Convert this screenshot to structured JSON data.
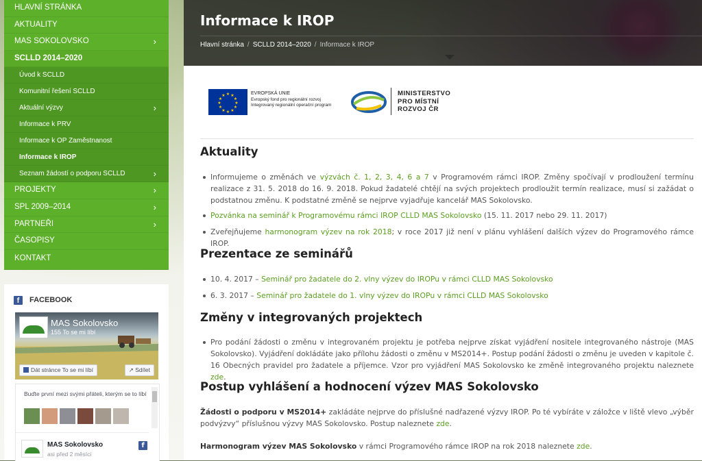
{
  "nav": {
    "top_items": [
      {
        "label": "HLAVNÍ STRÁNKA",
        "has_children": false
      },
      {
        "label": "AKTUALITY",
        "has_children": false
      },
      {
        "label": "MAS SOKOLOVSKO",
        "has_children": true
      },
      {
        "label": "SCLLD 2014–2020",
        "has_children": false
      }
    ],
    "sub_items": [
      {
        "label": "Úvod k SCLLD",
        "has_children": false
      },
      {
        "label": "Komunitní řešení SCLLD",
        "has_children": false
      },
      {
        "label": "Aktuální výzvy",
        "has_children": true
      },
      {
        "label": "Informace k PRV",
        "has_children": false
      },
      {
        "label": "Informace k OP Zaměstnanost",
        "has_children": false
      },
      {
        "label": "Informace k IROP",
        "has_children": false,
        "current": true
      },
      {
        "label": "Seznam žádostí o podporu SCLLD",
        "has_children": true
      }
    ],
    "bottom_items": [
      {
        "label": "PROJEKTY",
        "has_children": true
      },
      {
        "label": "SPL 2009–2014",
        "has_children": true
      },
      {
        "label": "PARTNEŘI",
        "has_children": true
      },
      {
        "label": "ČASOPISY",
        "has_children": false
      },
      {
        "label": "KONTAKT",
        "has_children": false
      }
    ],
    "chevron": "›"
  },
  "facebook": {
    "heading": "FACEBOOK",
    "logo_letter": "f",
    "page_name": "MAS Sokolovsko",
    "likes": "155 To se mi líbí",
    "like_button": "Dát stránce To se mi líbí",
    "share_button": "Sdílet",
    "friends_text": "Buďte první mezi svými přáteli, kterým se to líbí",
    "post_name": "MAS Sokolovsko",
    "post_time": "asi před 2 měsíci"
  },
  "header": {
    "title": "Informace k IROP",
    "breadcrumb": [
      "Hlavní stránka",
      "SCLLD 2014–2020",
      "Informace k IROP"
    ],
    "separator": "/"
  },
  "logos": {
    "eu_line1": "EVROPSKÁ UNIE",
    "eu_line2": "Evropský fond pro regionální rozvoj",
    "eu_line3": "Integrovaný regionální operační program",
    "mmr_line1": "MINISTERSTVO",
    "mmr_line2": "PRO MÍSTNÍ",
    "mmr_line3": "ROZVOJ ČR"
  },
  "sections": {
    "aktuality": {
      "heading": "Aktuality",
      "item1_a": "Informujeme o změnách ve ",
      "item1_link": "výzvách č. 1, 2, 3, 4, 6 a 7",
      "item1_b": " v Programovém rámci IROP. Změny spočívají v prodloužení termínu realizace z 31. 5. 2018 do 16. 9. 2018. Pokud žadatelé chtějí na svých projektech prodloužit termín realizace, musí si zažádat o podstatnou změnu. K podstatné změně se nejprve vyjadřuje kancelář MAS Sokolovsko.",
      "item2_link": "Pozvánka na seminář k Programovému rámci IROP CLLD MAS Sokolovsko",
      "item2_b": " (15. 11. 2017 nebo 29. 11. 2017)",
      "item3_a": "Zveřejňujeme ",
      "item3_link": "harmonogram výzev na rok 2018",
      "item3_b": "; v roce 2017 již není v plánu vyhlášení dalších výzev do Programového rámce IROP."
    },
    "prezentace": {
      "heading": "Prezentace ze seminářů",
      "item1_a": "10. 4. 2017 – ",
      "item1_link": "Seminář pro žadatele do 2. vlny výzev do IROPu v rámci CLLD MAS Sokolovsko",
      "item2_a": "6. 3. 2017 – ",
      "item2_link": "Seminář pro žadatele do 1. vlny výzev do IROPu v rámci CLLD MAS Sokolovsko"
    },
    "zmeny": {
      "heading": "Změny v integrovaných projektech",
      "item1_a": "Pro podání žádosti o změnu v integrovaném projektu je potřeba nejprve získat vyjádření nositele integrovaného nástroje (MAS Sokolovsko). Vyjádření dokládáte jako přílohu žádosti o změnu v MS2014+. Postup podání žádosti o změnu je uveden v kapitole č. 16 Obecných pravidel pro žadatele a příjemce. Vzor pro vyjádření MAS Sokolovsko ke změně integrovaného projektu naleznete ",
      "item1_link": "zde",
      "item1_b": "."
    },
    "postup": {
      "heading": "Postup vyhlášení a hodnocení výzev MAS Sokolovsko",
      "p1_bold": "Žádosti o podporu v MS2014+",
      "p1_a": " zakládáte nejprve do příslušné nadřazené výzvy IROP. Po té vybíráte v záložce v liště vlevo „výběr podvýzvy“ příslušnou výzvy MAS Sokolovsko. Postup naleznete ",
      "p1_link": "zde",
      "p1_b": ".",
      "p2_bold": "Harmonogram výzev MAS Sokolovsko",
      "p2_a": " v rámci Programového rámce IROP na rok 2018 naleznete ",
      "p2_link": "zde",
      "p2_b": "."
    }
  }
}
